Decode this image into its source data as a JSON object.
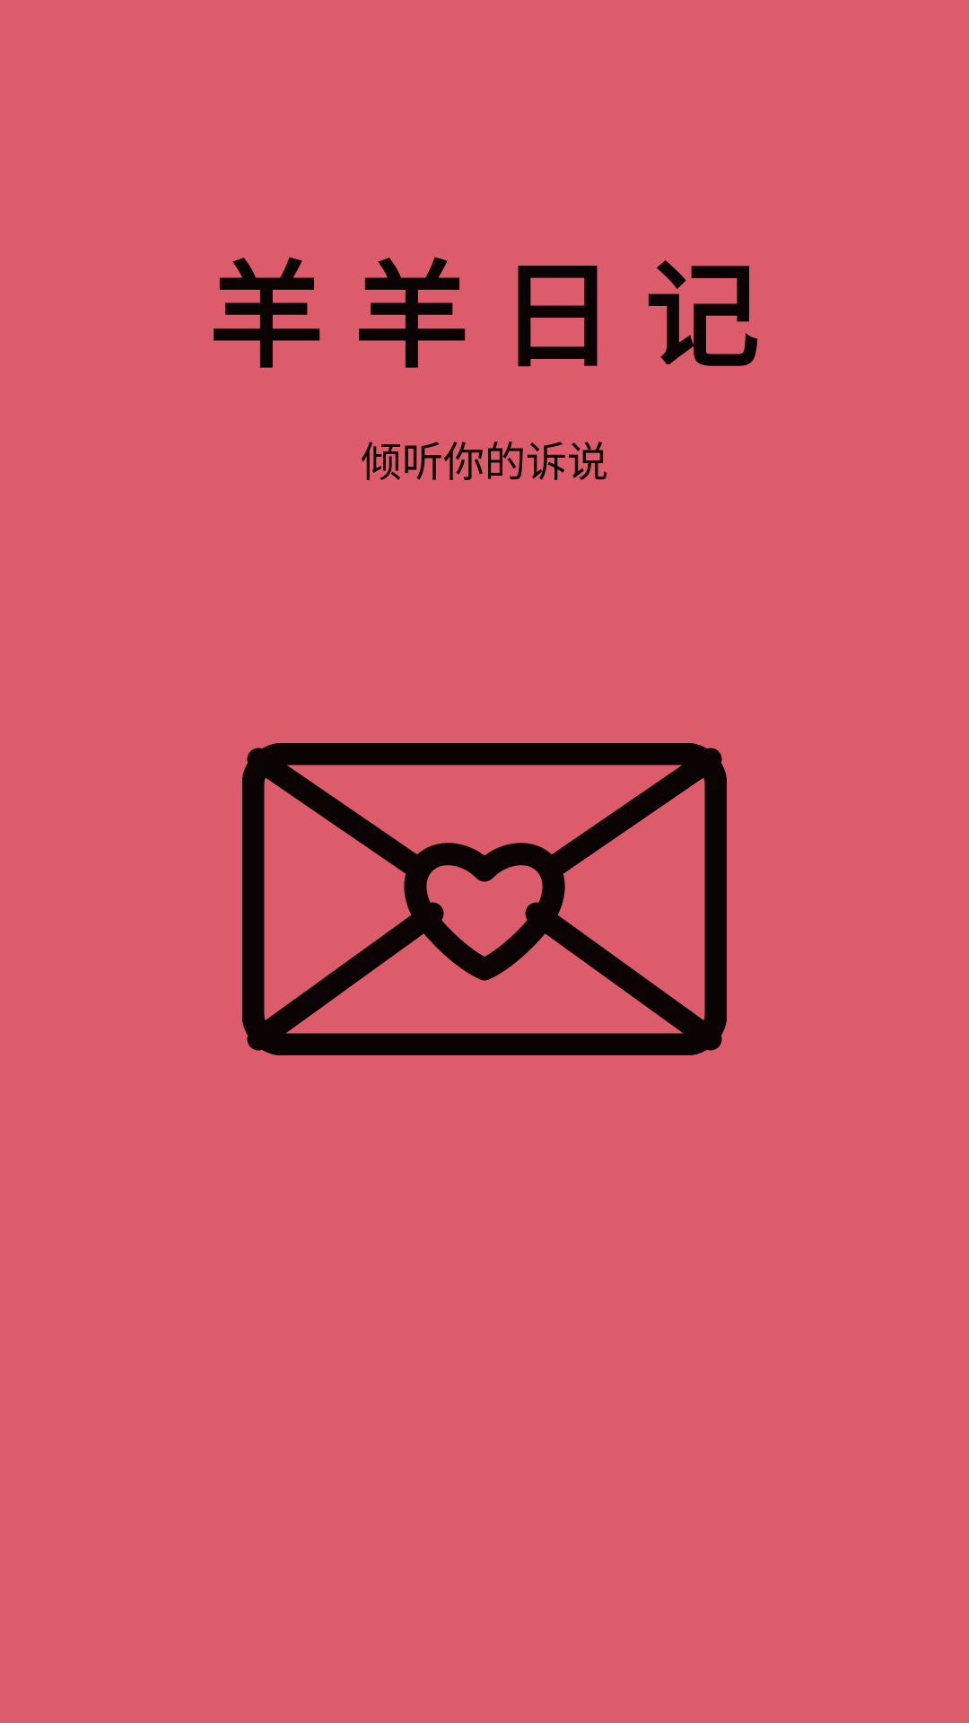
{
  "splash": {
    "title": "羊羊日记",
    "subtitle": "倾听你的诉说",
    "icon": "envelope-heart-icon"
  },
  "colors": {
    "background": "#DC5C6C",
    "foreground": "#0b0203"
  }
}
